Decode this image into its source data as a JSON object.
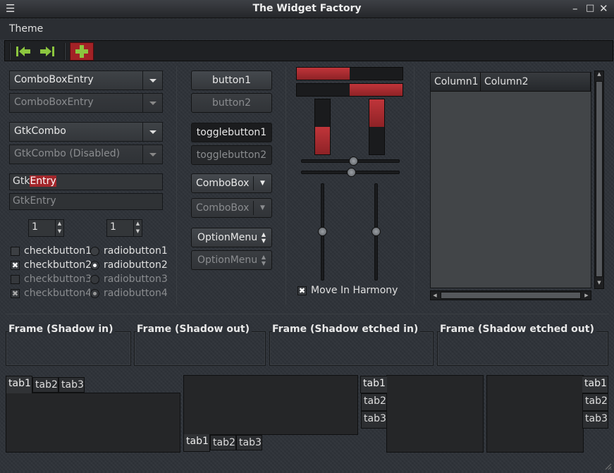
{
  "window": {
    "title": "The Widget Factory"
  },
  "menubar": {
    "theme": "Theme"
  },
  "toolbar": {
    "icons": [
      "go-first-icon",
      "go-last-icon",
      "add-icon"
    ]
  },
  "combos": {
    "comboboxentry": "ComboBoxEntry",
    "comboboxentry_disabled": "ComboBoxEntry",
    "gtkcombo": "GtkCombo",
    "gtkcombo_disabled": "GtkCombo (Disabled)"
  },
  "entries": {
    "entry1_prefix": "Gtk",
    "entry1_selected": "Entry",
    "entry2": "GtkEntry"
  },
  "spins": {
    "spin1": "1",
    "spin2": "1"
  },
  "checks": [
    {
      "label": "checkbutton1",
      "checked": false,
      "disabled": false
    },
    {
      "label": "checkbutton2",
      "checked": true,
      "disabled": false
    },
    {
      "label": "checkbutton3",
      "checked": false,
      "disabled": true
    },
    {
      "label": "checkbutton4",
      "checked": true,
      "disabled": true
    }
  ],
  "radios": [
    {
      "label": "radiobutton1",
      "selected": false,
      "disabled": false
    },
    {
      "label": "radiobutton2",
      "selected": true,
      "disabled": false
    },
    {
      "label": "radiobutton3",
      "selected": false,
      "disabled": true
    },
    {
      "label": "radiobutton4",
      "selected": true,
      "disabled": true
    }
  ],
  "buttons": {
    "button1": "button1",
    "button2": "button2",
    "toggle1": "togglebutton1",
    "toggle2": "togglebutton2",
    "combobox": "ComboBox",
    "combobox_disabled": "ComboBox",
    "optionmenu": "OptionMenu",
    "optionmenu_disabled": "OptionMenu"
  },
  "progress": {
    "h1_fraction": 0.5,
    "h2_fraction": 0.5,
    "v1_fraction": 0.5,
    "v2_fraction": 0.5
  },
  "scales": {
    "h1_value": 0.5,
    "h2_value": 0.5,
    "v1_value": 0.5,
    "v2_value": 0.5
  },
  "harmony": {
    "label": "Move In Harmony",
    "checked": true
  },
  "tree": {
    "columns": [
      "Column1",
      "Column2"
    ]
  },
  "frames": [
    "Frame (Shadow in)",
    "Frame (Shadow out)",
    "Frame (Shadow etched in)",
    "Frame (Shadow etched out)"
  ],
  "notebooks": {
    "top": [
      "tab1",
      "tab2",
      "tab3"
    ],
    "bottom": [
      "tab1",
      "tab2",
      "tab3"
    ],
    "left": [
      "tab1",
      "tab2",
      "tab3"
    ],
    "right": [
      "tab1",
      "tab2",
      "tab3"
    ]
  },
  "colors": {
    "accent": "#a3272b",
    "toolbar_arrow": "#8cc63f",
    "add_button": "#a32226"
  }
}
